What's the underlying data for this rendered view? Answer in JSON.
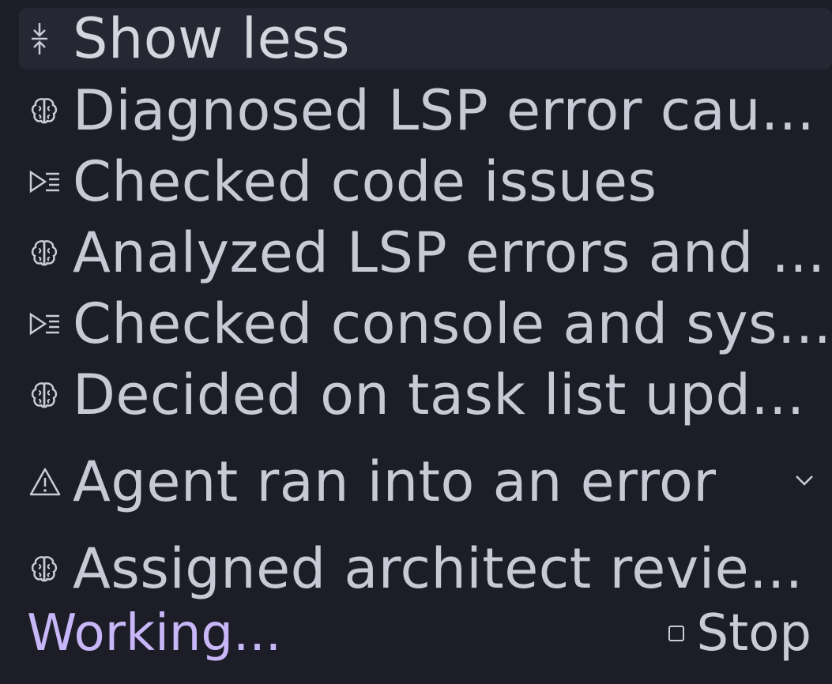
{
  "show_less": {
    "label": "Show less",
    "icon": "collapse-icon"
  },
  "steps": [
    {
      "icon": "brain-icon",
      "label": "Diagnosed LSP error cau..."
    },
    {
      "icon": "console-icon",
      "label": "Checked code issues"
    },
    {
      "icon": "brain-icon",
      "label": "Analyzed LSP errors and ..."
    },
    {
      "icon": "console-icon",
      "label": "Checked console and sys..."
    },
    {
      "icon": "brain-icon",
      "label": "Decided on task list upd..."
    },
    {
      "icon": "warning-icon",
      "label": "Agent ran into an error",
      "expandable": true
    },
    {
      "icon": "brain-icon",
      "label": "Assigned architect revie..."
    }
  ],
  "footer": {
    "status": "Working...",
    "stop_label": "Stop"
  },
  "colors": {
    "background": "#1c1d26",
    "text": "#c7cad4",
    "accent_working": "#c7b6f8",
    "highlight_row": "#252733"
  }
}
